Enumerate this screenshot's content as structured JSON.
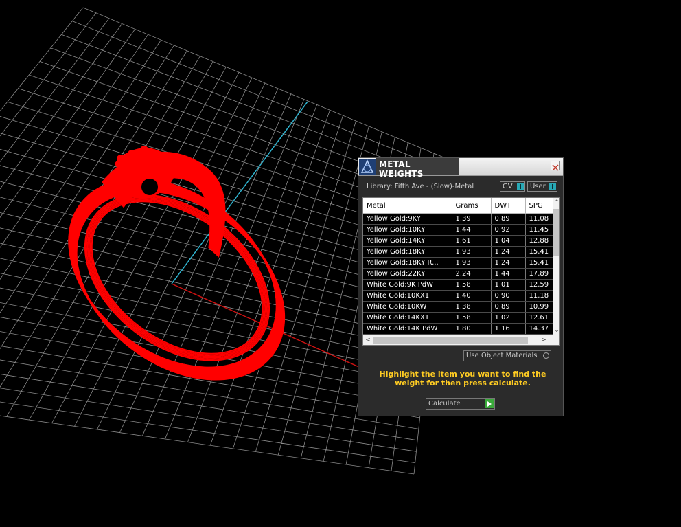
{
  "window": {
    "title": "METAL WEIGHTS"
  },
  "library_label": "Library: Fifth Ave - (Slow)-Metal",
  "toggles": {
    "gv": "GV",
    "user": "User"
  },
  "table": {
    "headers": [
      "Metal",
      "Grams",
      "DWT",
      "SPG"
    ],
    "rows": [
      [
        "Yellow Gold:9KY",
        "1.39",
        "0.89",
        "11.08"
      ],
      [
        "Yellow Gold:10KY",
        "1.44",
        "0.92",
        "11.45"
      ],
      [
        "Yellow Gold:14KY",
        "1.61",
        "1.04",
        "12.88"
      ],
      [
        "Yellow Gold:18KY",
        "1.93",
        "1.24",
        "15.41"
      ],
      [
        "Yellow Gold:18KY R...",
        "1.93",
        "1.24",
        "15.41"
      ],
      [
        "Yellow Gold:22KY",
        "2.24",
        "1.44",
        "17.89"
      ],
      [
        "White Gold:9K PdW",
        "1.58",
        "1.01",
        "12.59"
      ],
      [
        "White Gold:10KX1",
        "1.40",
        "0.90",
        "11.18"
      ],
      [
        "White Gold:10KW",
        "1.38",
        "0.89",
        "10.99"
      ],
      [
        "White Gold:14KX1",
        "1.58",
        "1.02",
        "12.61"
      ],
      [
        "White Gold:14K PdW",
        "1.80",
        "1.16",
        "14.37"
      ]
    ]
  },
  "material_dropdown": {
    "value": "Use Object Materials"
  },
  "hint": "Highlight the item you want to find the weight for then press calculate.",
  "calculate_label": "Calculate",
  "colors": {
    "model": "#ff0000",
    "grid": "#8c8c8c",
    "y_axis": "#2fb3cf",
    "x_axis": "#cc1111",
    "hint": "#ffcc22",
    "toggle_knob": "#28a8b5"
  }
}
